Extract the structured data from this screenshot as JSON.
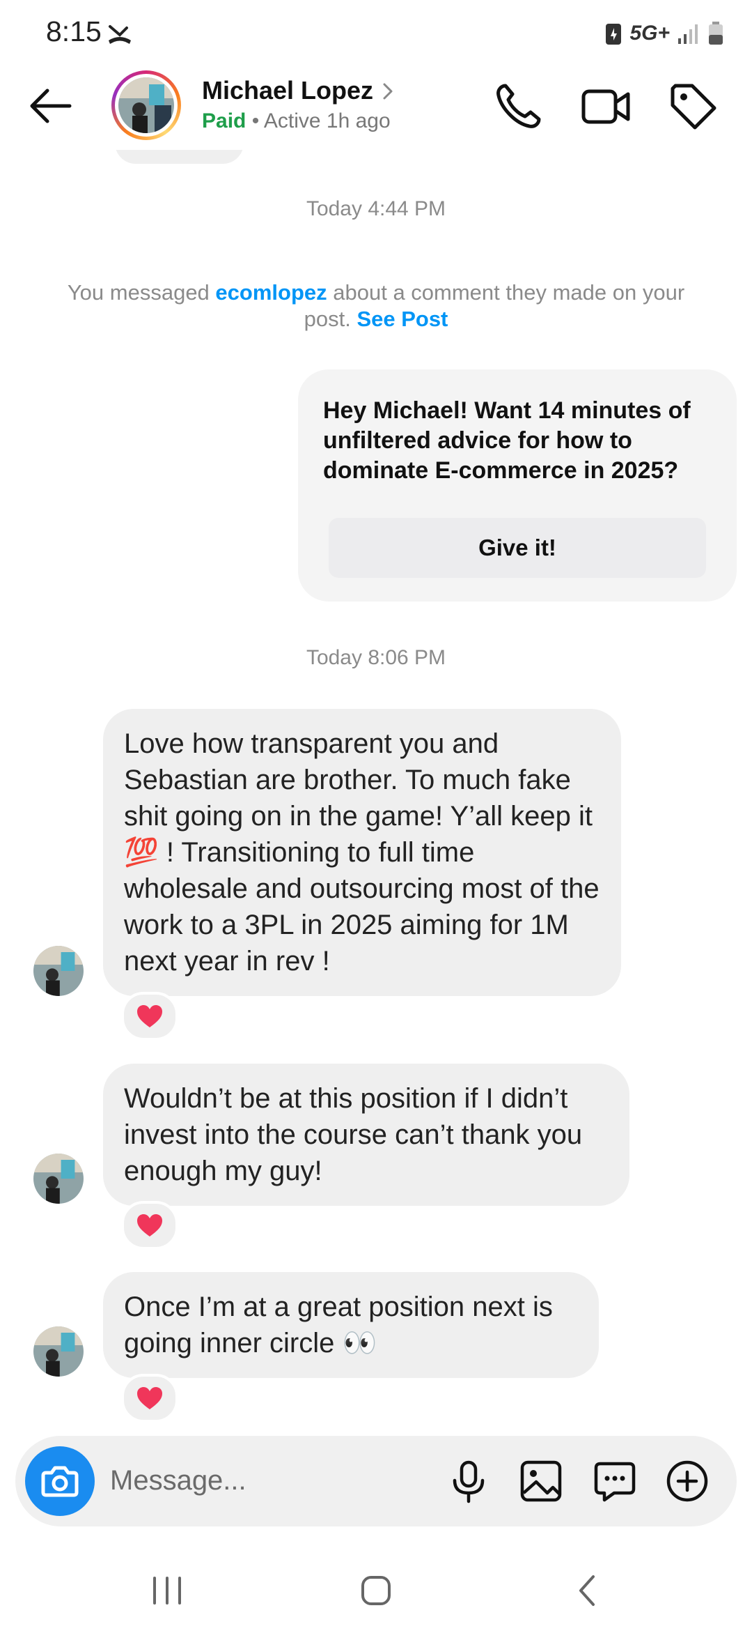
{
  "status_bar": {
    "time": "8:15",
    "network": "5G+"
  },
  "header": {
    "contact_name": "Michael Lopez",
    "label": "Paid",
    "separator": " • ",
    "active_status": "Active 1h ago"
  },
  "conversation": {
    "timestamp_1": "Today 4:44 PM",
    "context_note": {
      "prefix": "You messaged ",
      "username": "ecomlopez",
      "middle": " about a comment they made on your post. ",
      "link": "See Post"
    },
    "card": {
      "text": "Hey Michael! Want 14 minutes of unfiltered advice for how to dominate E-commerce in 2025?",
      "button": "Give it!"
    },
    "timestamp_2": "Today 8:06 PM",
    "messages": [
      {
        "text": "Love how transparent you and Sebastian are brother. To much fake shit going on in the game! Y’all keep it 💯 ! Transitioning to full time wholesale and outsourcing most of the work to a 3PL in 2025 aiming for 1M next year in rev !",
        "reaction": "heart"
      },
      {
        "text": "Wouldn’t be at this position if I didn’t invest into the course can’t thank you enough my guy!",
        "reaction": "heart"
      },
      {
        "text": "Once I’m at a great position next is going inner circle 👀",
        "reaction": "heart"
      }
    ]
  },
  "composer": {
    "placeholder": "Message..."
  },
  "colors": {
    "accent": "#0095f6",
    "paid": "#1e9e4a",
    "bubble": "#efefef",
    "reaction_heart": "#f0365a"
  }
}
